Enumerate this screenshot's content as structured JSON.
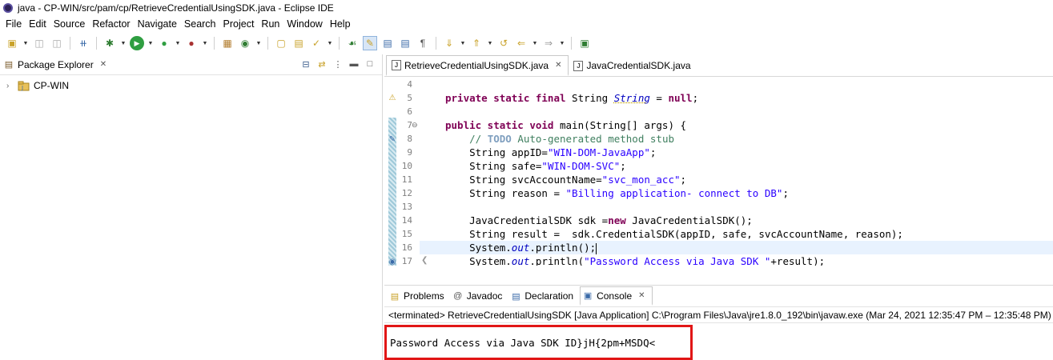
{
  "window": {
    "title": "java - CP-WIN/src/pam/cp/RetrieveCredentialUsingSDK.java - Eclipse IDE"
  },
  "menu": [
    "File",
    "Edit",
    "Source",
    "Refactor",
    "Navigate",
    "Search",
    "Project",
    "Run",
    "Window",
    "Help"
  ],
  "left_panel": {
    "tab_label": "Package Explorer",
    "tree": [
      {
        "label": "CP-WIN"
      }
    ]
  },
  "editor": {
    "tabs": [
      {
        "label": "RetrieveCredentialUsingSDK.java",
        "active": true
      },
      {
        "label": "JavaCredentialSDK.java",
        "active": false
      }
    ],
    "line_numbers": [
      "4",
      "5",
      "6",
      "7",
      "8",
      "9",
      "10",
      "11",
      "12",
      "13",
      "14",
      "15",
      "16",
      "17"
    ],
    "code": {
      "l5_field": "String",
      "l9_value": "\"WIN-DOM-JavaApp\"",
      "l10_value": "\"WIN-DOM-SVC\"",
      "l11_value": "\"svc_mon_acc\"",
      "l12_value": "\"Billing application- connect to DB\"",
      "l17_value": "\"Password Access via Java SDK \""
    }
  },
  "console": {
    "tabs": [
      "Problems",
      "Javadoc",
      "Declaration",
      "Console"
    ],
    "active_tab": "Console",
    "status": "<terminated> RetrieveCredentialUsingSDK [Java Application] C:\\Program Files\\Java\\jre1.8.0_192\\bin\\javaw.exe  (Mar 24, 2021 12:35:47 PM – 12:35:48 PM)",
    "output": "Password Access via Java SDK ID}jH{2pm+MSDQ<"
  },
  "colors": {
    "highlight_box": "#e11616",
    "current_line": "#e8f2fe",
    "keyword": "#7f0055",
    "string": "#2a00ff",
    "comment": "#3f7f5f"
  }
}
